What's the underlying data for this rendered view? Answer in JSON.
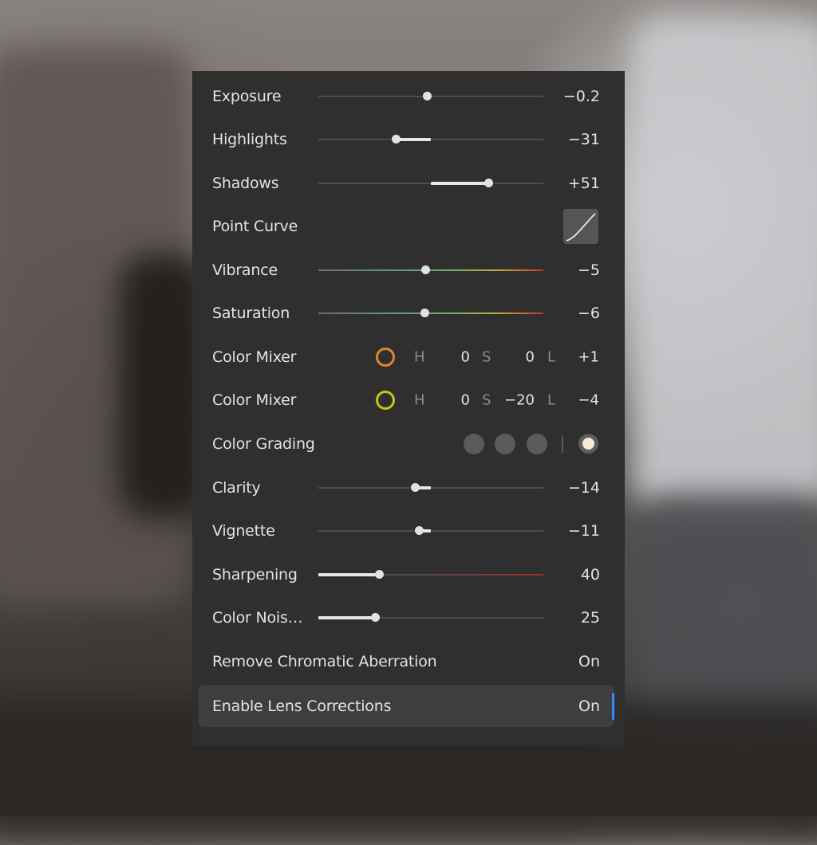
{
  "panel": {
    "rows": [
      {
        "label": "Exposure",
        "value": "−0.2",
        "position": 0.48
      },
      {
        "label": "Highlights",
        "value": "−31",
        "position": 0.345
      },
      {
        "label": "Shadows",
        "value": "+51",
        "position": 0.755
      },
      {
        "label": "Point Curve"
      },
      {
        "label": "Vibrance",
        "value": "−5",
        "position": 0.475
      },
      {
        "label": "Saturation",
        "value": "−6",
        "position": 0.47
      },
      {
        "label": "Color Mixer",
        "swatch_color": "#e0882a",
        "h": "0",
        "s": "0",
        "l": "+1",
        "h_letter": "H",
        "s_letter": "S",
        "l_letter": "L"
      },
      {
        "label": "Color Mixer",
        "swatch_color": "#c9c41a",
        "h": "0",
        "s": "−20",
        "l": "−4",
        "h_letter": "H",
        "s_letter": "S",
        "l_letter": "L"
      },
      {
        "label": "Color Grading"
      },
      {
        "label": "Clarity",
        "value": "−14",
        "position": 0.43
      },
      {
        "label": "Vignette",
        "value": "−11",
        "position": 0.445
      },
      {
        "label": "Sharpening",
        "value": "40",
        "position": 0.27
      },
      {
        "label": "Color Nois…",
        "value": "25",
        "position": 0.25
      },
      {
        "label": "Remove Chromatic Aberration",
        "value": "On"
      },
      {
        "label": "Enable Lens Corrections",
        "value": "On"
      }
    ]
  },
  "colors": {
    "panel_bg": "#2f2f2f",
    "selection_accent": "#2f8dff",
    "orange_swatch": "#e0882a",
    "yellow_swatch": "#c9c41a"
  },
  "icons": {
    "point_curve": "curve-icon",
    "color_grading": "color-wheel-dots"
  }
}
